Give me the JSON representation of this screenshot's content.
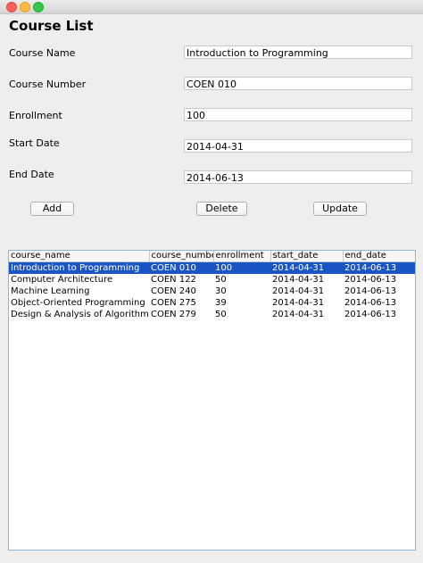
{
  "window": {
    "title": "Course List"
  },
  "form": {
    "course_name": {
      "label": "Course Name",
      "value": "Introduction to Programming"
    },
    "course_number": {
      "label": "Course Number",
      "value": "COEN 010"
    },
    "enrollment": {
      "label": "Enrollment",
      "value": "100"
    },
    "start_date": {
      "label": "Start Date",
      "value": "2014-04-31"
    },
    "end_date": {
      "label": "End Date",
      "value": "2014-06-13"
    }
  },
  "buttons": {
    "add": "Add",
    "delete": "Delete",
    "update": "Update"
  },
  "table": {
    "columns": [
      "course_name",
      "course_number",
      "enrollment",
      "start_date",
      "end_date"
    ],
    "rows": [
      [
        "Introduction to Programming",
        "COEN 010",
        "100",
        "2014-04-31",
        "2014-06-13"
      ],
      [
        "Computer Architecture",
        "COEN 122",
        "50",
        "2014-04-31",
        "2014-06-13"
      ],
      [
        "Machine Learning",
        "COEN 240",
        "30",
        "2014-04-31",
        "2014-06-13"
      ],
      [
        "Object-Oriented Programming",
        "COEN 275",
        "39",
        "2014-04-31",
        "2014-06-13"
      ],
      [
        "Design & Analysis of Algorithms",
        "COEN 279",
        "50",
        "2014-04-31",
        "2014-06-13"
      ]
    ],
    "selected_row": 0
  }
}
